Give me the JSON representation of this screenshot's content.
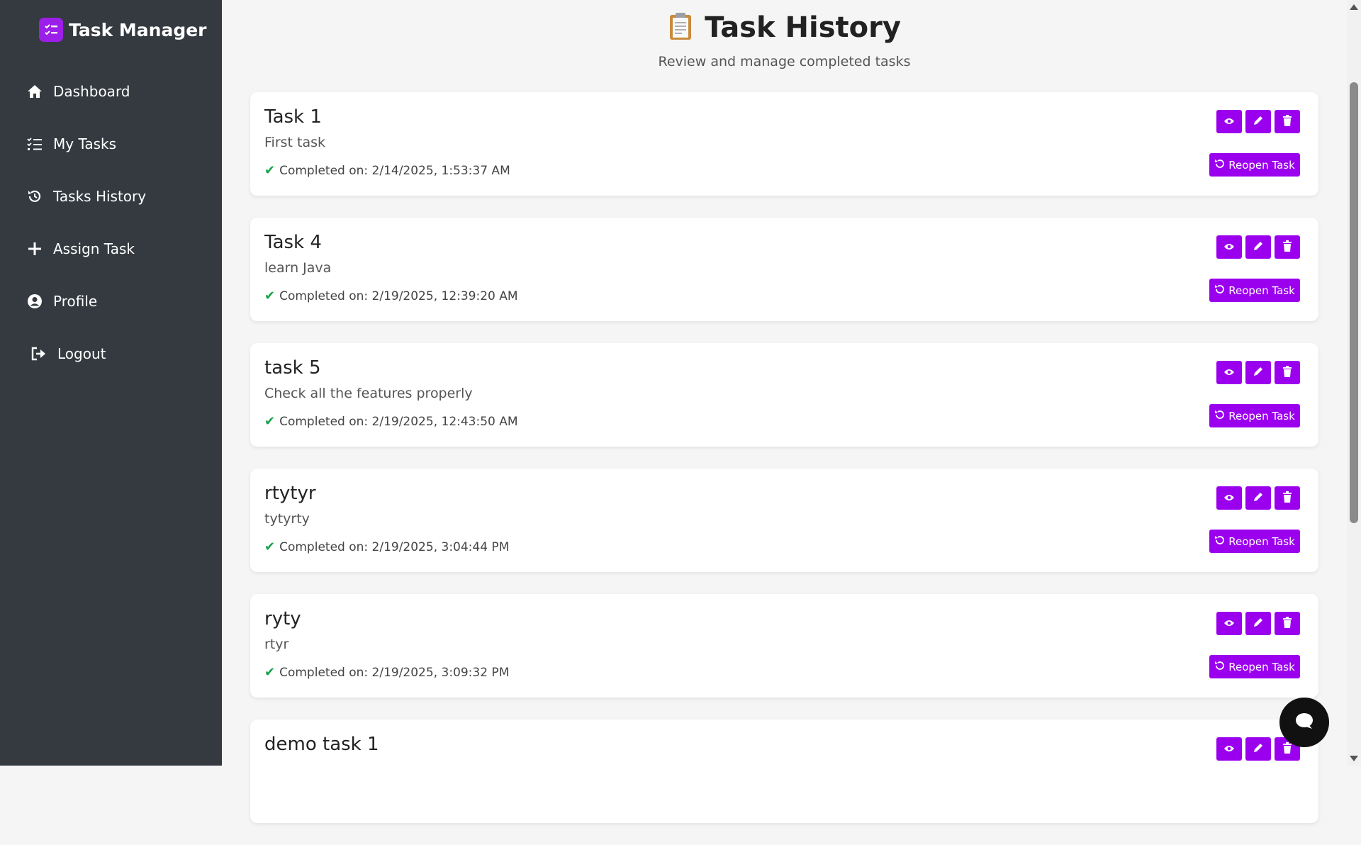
{
  "app": {
    "brand_title": "Task Manager"
  },
  "sidebar": {
    "items": [
      {
        "label": "Dashboard",
        "icon": "home-icon"
      },
      {
        "label": "My Tasks",
        "icon": "list-check-icon"
      },
      {
        "label": "Tasks History",
        "icon": "history-icon"
      },
      {
        "label": "Assign Task",
        "icon": "plus-icon"
      },
      {
        "label": "Profile",
        "icon": "user-circle-icon"
      },
      {
        "label": "Logout",
        "icon": "logout-icon"
      }
    ]
  },
  "header": {
    "icon": "clipboard-icon",
    "title": "Task History",
    "subtitle": "Review and manage completed tasks"
  },
  "tasks": [
    {
      "title": "Task 1",
      "description": "First task",
      "completed": "Completed on: 2/14/2025, 1:53:37 AM",
      "reopen_label": "Reopen Task"
    },
    {
      "title": "Task 4",
      "description": "learn Java",
      "completed": "Completed on: 2/19/2025, 12:39:20 AM",
      "reopen_label": "Reopen Task"
    },
    {
      "title": "task 5",
      "description": "Check all the features properly",
      "completed": "Completed on: 2/19/2025, 12:43:50 AM",
      "reopen_label": "Reopen Task"
    },
    {
      "title": "rtytyr",
      "description": "tytyrty",
      "completed": "Completed on: 2/19/2025, 3:04:44 PM",
      "reopen_label": "Reopen Task"
    },
    {
      "title": "ryty",
      "description": "rtyr",
      "completed": "Completed on: 2/19/2025, 3:09:32 PM",
      "reopen_label": "Reopen Task"
    },
    {
      "title": "demo task 1",
      "description": "",
      "completed": "",
      "reopen_label": ""
    }
  ],
  "colors": {
    "accent": "#9b00ee",
    "sidebar_bg": "#343a40",
    "check": "#16a34a"
  }
}
